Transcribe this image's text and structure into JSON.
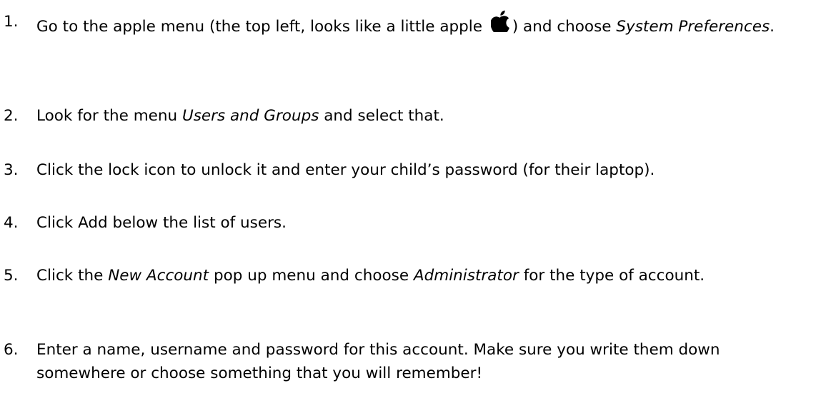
{
  "steps": [
    {
      "number": "1.",
      "text_before": "Go to the apple menu (the top left, looks like a little apple ",
      "icon": "apple-logo-icon",
      "text_middle": ") and choose ",
      "emphasis": "System Preferences",
      "text_after": "."
    },
    {
      "number": "2.",
      "text_before": "Look for the menu ",
      "emphasis": "Users and Groups",
      "text_after": " and select that."
    },
    {
      "number": "3.",
      "text": "Click the lock icon to unlock it and enter your child’s password (for their laptop)."
    },
    {
      "number": "4.",
      "text": "Click Add below the list of users."
    },
    {
      "number": "5.",
      "text_before": "Click the ",
      "emphasis_1": "New Account",
      "text_middle": " pop up menu and choose ",
      "emphasis_2": "Administrator",
      "text_after": " for the type of account."
    },
    {
      "number": "6.",
      "text": "Enter a name, username and password for this account. Make sure you write them down somewhere or choose something that you will remember!"
    }
  ]
}
